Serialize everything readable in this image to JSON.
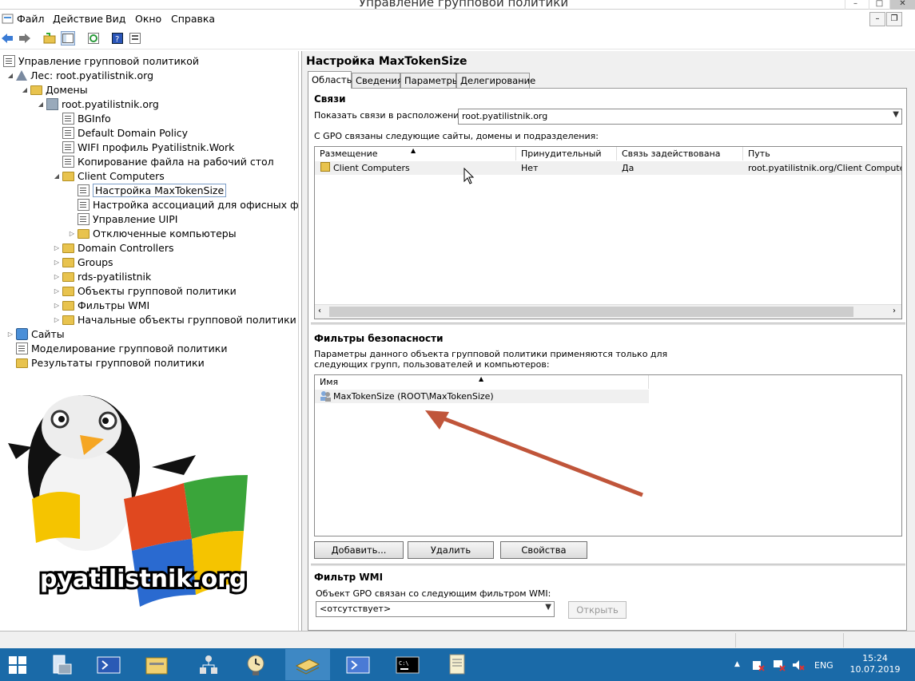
{
  "window": {
    "title": "Управление групповой политики"
  },
  "menu": [
    "Файл",
    "Действие",
    "Вид",
    "Окно",
    "Справка"
  ],
  "tree": [
    {
      "label": "Управление групповой политикой",
      "icon": "gpmc-icon",
      "level": 0,
      "exp": ""
    },
    {
      "label": "Лес: root.pyatilistnik.org",
      "icon": "forest-icon",
      "level": 1,
      "exp": "◢"
    },
    {
      "label": "Домены",
      "icon": "folder-icon",
      "level": 2,
      "exp": "◢"
    },
    {
      "label": "root.pyatilistnik.org",
      "icon": "domain-icon",
      "level": 3,
      "exp": "◢"
    },
    {
      "label": "BGInfo",
      "icon": "gpo-link-icon",
      "level": 4,
      "exp": ""
    },
    {
      "label": "Default Domain Policy",
      "icon": "gpo-link-icon",
      "level": 4,
      "exp": ""
    },
    {
      "label": "WIFI профиль Pyatilistnik.Work",
      "icon": "gpo-link-icon",
      "level": 4,
      "exp": ""
    },
    {
      "label": "Копирование файла на рабочий стол",
      "icon": "gpo-link-icon",
      "level": 4,
      "exp": ""
    },
    {
      "label": "Client Computers",
      "icon": "folder-icon",
      "level": 4,
      "exp": "◢"
    },
    {
      "label": "Настройка MaxTokenSize",
      "icon": "gpo-link-icon",
      "level": 5,
      "exp": "",
      "selected": true
    },
    {
      "label": "Настройка ассоциаций для офисных файлов",
      "icon": "gpo-link-icon",
      "level": 5,
      "exp": ""
    },
    {
      "label": "Управление UIPI",
      "icon": "gpo-link-icon",
      "level": 5,
      "exp": ""
    },
    {
      "label": "Отключенные компьютеры",
      "icon": "folder-icon",
      "level": 5,
      "exp": "▷"
    },
    {
      "label": "Domain Controllers",
      "icon": "folder-icon",
      "level": 4,
      "exp": "▷"
    },
    {
      "label": "Groups",
      "icon": "folder-icon",
      "level": 4,
      "exp": "▷"
    },
    {
      "label": "rds-pyatilistnik",
      "icon": "folder-icon",
      "level": 4,
      "exp": "▷"
    },
    {
      "label": "Объекты групповой политики",
      "icon": "folder-icon",
      "level": 4,
      "exp": "▷"
    },
    {
      "label": "Фильтры WMI",
      "icon": "folder-icon",
      "level": 4,
      "exp": "▷"
    },
    {
      "label": "Начальные объекты групповой политики",
      "icon": "folder-icon",
      "level": 4,
      "exp": "▷"
    },
    {
      "label": "Сайты",
      "icon": "sites-icon",
      "level": 1,
      "exp": "▷"
    },
    {
      "label": "Моделирование групповой политики",
      "icon": "modeling-icon",
      "level": 1,
      "exp": ""
    },
    {
      "label": "Результаты групповой политики",
      "icon": "results-icon",
      "level": 1,
      "exp": ""
    }
  ],
  "logo": {
    "text": "pyatilistnik.org"
  },
  "details": {
    "title": "Настройка MaxTokenSize",
    "tabs": [
      "Область",
      "Сведения",
      "Параметры",
      "Делегирование"
    ],
    "links": {
      "heading": "Связи",
      "location_label": "Показать связи в расположении:",
      "location_value": "root.pyatilistnik.org",
      "desc": "С GPO связаны следующие сайты, домены и подразделения:",
      "columns": [
        "Размещение",
        "Принудительный",
        "Связь задействована",
        "Путь"
      ],
      "rows": [
        {
          "place": "Client Computers",
          "enforced": "Нет",
          "enabled": "Да",
          "path": "root.pyatilistnik.org/Client Computers"
        }
      ]
    },
    "security": {
      "heading": "Фильтры безопасности",
      "desc1": "Параметры данного объекта групповой политики применяются только для",
      "desc2": "следующих групп, пользователей и компьютеров:",
      "column": "Имя",
      "rows": [
        "MaxTokenSize (ROOT\\MaxTokenSize)"
      ],
      "add": "Добавить...",
      "remove": "Удалить",
      "properties": "Свойства"
    },
    "wmi": {
      "heading": "Фильтр WMI",
      "desc": "Объект GPO связан со следующим фильтром WMI:",
      "value": "<отсутствует>",
      "open": "Открыть"
    }
  },
  "taskbar": {
    "lang": "ENG",
    "time": "15:24",
    "date": "10.07.2019"
  }
}
